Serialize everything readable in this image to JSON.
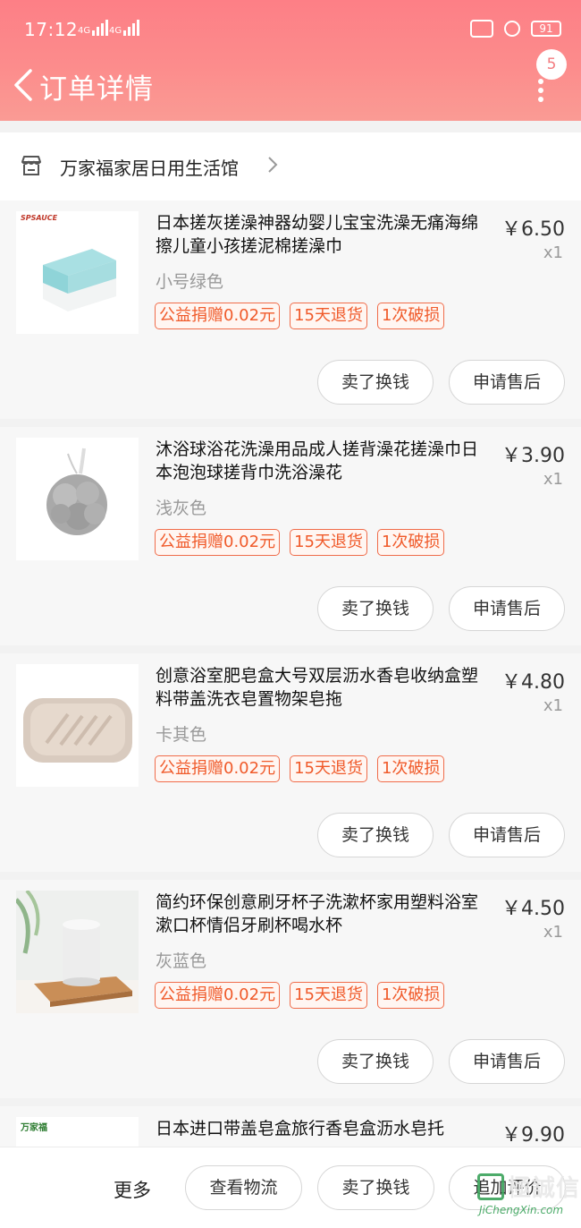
{
  "status_bar": {
    "time": "17:12",
    "battery": "91",
    "net1": "4G",
    "net2": "4G"
  },
  "nav": {
    "title": "订单详情",
    "badge_count": "5"
  },
  "shop": {
    "name": "万家福家居日用生活馆"
  },
  "items": [
    {
      "title": "日本搓灰搓澡神器幼婴儿宝宝洗澡无痛海绵擦儿童小孩搓泥棉搓澡巾",
      "price": "￥6.50",
      "qty": "x1",
      "sku": "小号绿色",
      "thumb_brand": "SPSAUCE",
      "tags": [
        "公益捐赠0.02元",
        "15天退货",
        "1次破损"
      ],
      "btn_sell": "卖了换钱",
      "btn_after": "申请售后"
    },
    {
      "title": "沐浴球浴花洗澡用品成人搓背澡花搓澡巾日本泡泡球搓背巾洗浴澡花",
      "price": "￥3.90",
      "qty": "x1",
      "sku": "浅灰色",
      "tags": [
        "公益捐赠0.02元",
        "15天退货",
        "1次破损"
      ],
      "btn_sell": "卖了换钱",
      "btn_after": "申请售后"
    },
    {
      "title": "创意浴室肥皂盒大号双层沥水香皂收纳盒塑料带盖洗衣皂置物架皂拖",
      "price": "￥4.80",
      "qty": "x1",
      "sku": "卡其色",
      "tags": [
        "公益捐赠0.02元",
        "15天退货",
        "1次破损"
      ],
      "btn_sell": "卖了换钱",
      "btn_after": "申请售后"
    },
    {
      "title": "简约环保创意刷牙杯子洗漱杯家用塑料浴室漱口杯情侣牙刷杯喝水杯",
      "price": "￥4.50",
      "qty": "x1",
      "sku": "灰蓝色",
      "tags": [
        "公益捐赠0.02元",
        "15天退货",
        "1次破损"
      ],
      "btn_sell": "卖了换钱",
      "btn_after": "申请售后"
    },
    {
      "title": "日本进口带盖皂盒旅行香皂盒沥水皂托",
      "price": "￥9.90",
      "thumb_brand": "万家福"
    }
  ],
  "bottom_bar": {
    "more": "更多",
    "logistics": "查看物流",
    "sell": "卖了换钱",
    "review": "追加评价"
  },
  "watermark": {
    "cn": "極誠信",
    "en": "JiChengXin.com"
  }
}
